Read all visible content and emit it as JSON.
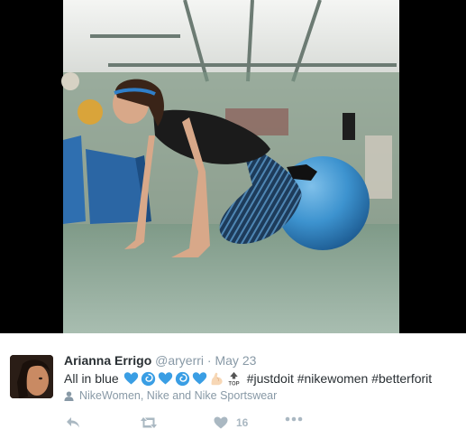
{
  "tweet": {
    "author_name": "Arianna Errigo",
    "handle": "@aryerri",
    "separator": "·",
    "date": "May 23",
    "text_prefix": "All in blue",
    "hashtags": "#justdoit #nikewomen #betterforit",
    "emojis": [
      "blue-heart-icon",
      "cyclone-icon",
      "blue-heart-icon",
      "cyclone-icon",
      "blue-heart-icon",
      "flexed-biceps-icon",
      "top-arrow-icon"
    ],
    "tagged_people": "NikeWomen, Nike and Nike Sportswear",
    "like_count": "16"
  },
  "colors": {
    "name": "#292f33",
    "secondary": "#8899a6",
    "action": "#aab8c2",
    "emoji_blue": "#3a9ee4"
  },
  "photo": {
    "description_icon": "woman-exercising-on-fitness-ball-photo"
  }
}
